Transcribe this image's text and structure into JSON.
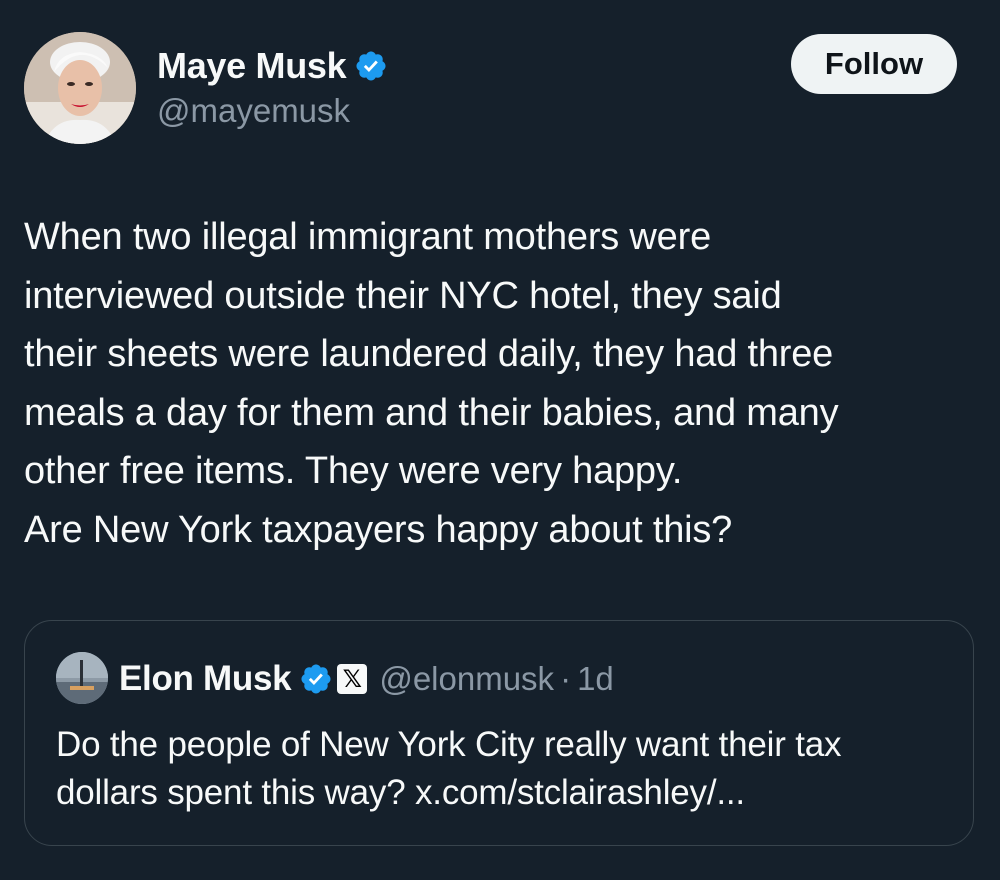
{
  "author": {
    "display_name": "Maye Musk",
    "handle": "@mayemusk",
    "verified_icon": "verified-badge-icon",
    "avatar_icon": "avatar"
  },
  "follow_button": {
    "label": "Follow"
  },
  "tweet": {
    "lines": [
      "When two illegal immigrant mothers were",
      "interviewed outside their NYC hotel, they said",
      "their sheets were laundered daily, they had three",
      "meals a day for them and their babies, and many",
      "other free items. They were very happy.",
      "Are New York taxpayers happy about this?"
    ]
  },
  "quote": {
    "display_name": "Elon Musk",
    "affiliate_badge": "𝕏",
    "handle": "@elonmusk",
    "separator": "·",
    "time": "1d",
    "lines": [
      "Do the people of New York City really want their tax",
      "dollars spent this way? x.com/stclairashley/..."
    ]
  },
  "colors": {
    "background": "#15202b",
    "text": "#f7f9f9",
    "secondary_text": "#8b98a5",
    "verified_blue": "#1d9bf0",
    "border": "#38444d",
    "follow_bg": "#eff3f4"
  }
}
